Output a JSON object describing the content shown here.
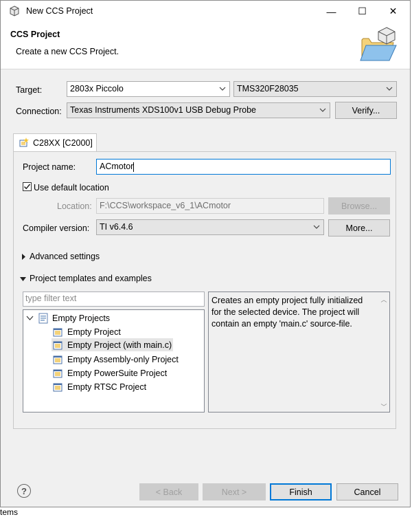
{
  "window": {
    "title": "New CCS Project",
    "minimize": "—",
    "maximize": "☐",
    "close": "✕"
  },
  "header": {
    "title": "CCS Project",
    "description": "Create a new CCS Project."
  },
  "target": {
    "label": "Target:",
    "family": "2803x Piccolo",
    "device": "TMS320F28035"
  },
  "connection": {
    "label": "Connection:",
    "value": "Texas Instruments XDS100v1 USB Debug Probe",
    "verify_label": "Verify..."
  },
  "tab": {
    "label": "C28XX [C2000]"
  },
  "project": {
    "name_label": "Project name:",
    "name_value": "ACmotor",
    "use_default_location_label": "Use default location",
    "use_default_location_checked": true,
    "location_label": "Location:",
    "location_value": "F:\\CCS\\workspace_v6_1\\ACmotor",
    "browse_label": "Browse...",
    "compiler_label": "Compiler version:",
    "compiler_value": "TI v6.4.6",
    "more_label": "More..."
  },
  "sections": {
    "advanced": "Advanced settings",
    "templates": "Project templates and examples"
  },
  "templates": {
    "filter_placeholder": "type filter text",
    "group": "Empty Projects",
    "items": [
      "Empty Project",
      "Empty Project (with main.c)",
      "Empty Assembly-only Project",
      "Empty PowerSuite Project",
      "Empty RTSC Project"
    ],
    "selected_index": 1,
    "description": "Creates an empty project fully initialized for the selected device. The project will contain an empty 'main.c' source-file."
  },
  "buttons": {
    "help": "?",
    "back": "< Back",
    "next": "Next >",
    "finish": "Finish",
    "cancel": "Cancel"
  },
  "background": {
    "status_fragment": "tems"
  }
}
